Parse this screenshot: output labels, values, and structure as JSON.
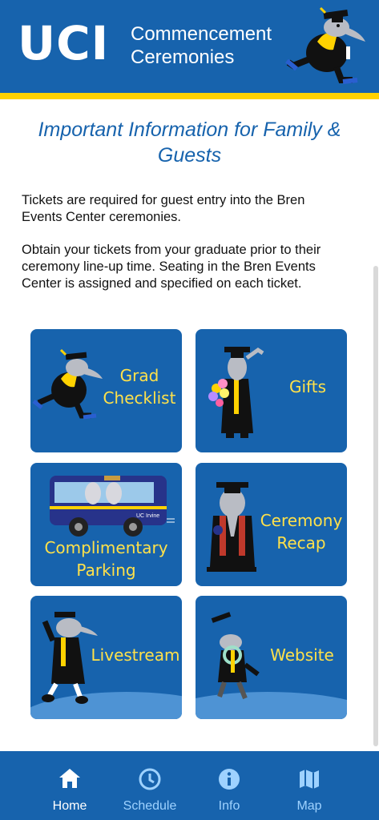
{
  "header": {
    "logo": "UCI",
    "title_line1": "Commencement",
    "title_line2": "Ceremonies"
  },
  "content": {
    "heading": "Important Information for Family & Guests",
    "paragraph1": "Tickets are required for guest entry into the Bren Events Center ceremonies.",
    "paragraph2": "Obtain your tickets from your graduate prior to their ceremony line-up time. Seating in the Bren Events Center is assigned and specified on each ticket."
  },
  "tiles": [
    {
      "label_line1": "Grad",
      "label_line2": "Checklist"
    },
    {
      "label": "Gifts"
    },
    {
      "label_line1": "Complimentary",
      "label_line2": "Parking",
      "bus_text": "UC Irvine"
    },
    {
      "label_line1": "Ceremony",
      "label_line2": "Recap"
    },
    {
      "label": "Livestream"
    },
    {
      "label": "Website"
    }
  ],
  "nav": {
    "items": [
      {
        "label": "Home",
        "icon": "home-icon",
        "active": true
      },
      {
        "label": "Schedule",
        "icon": "clock-icon",
        "active": false
      },
      {
        "label": "Info",
        "icon": "info-icon",
        "active": false
      },
      {
        "label": "Map",
        "icon": "map-icon",
        "active": false
      }
    ]
  },
  "colors": {
    "brand_blue": "#1763ad",
    "gold": "#ffd200",
    "tile_text": "#ffe14a",
    "nav_inactive": "#9ed2ff"
  }
}
